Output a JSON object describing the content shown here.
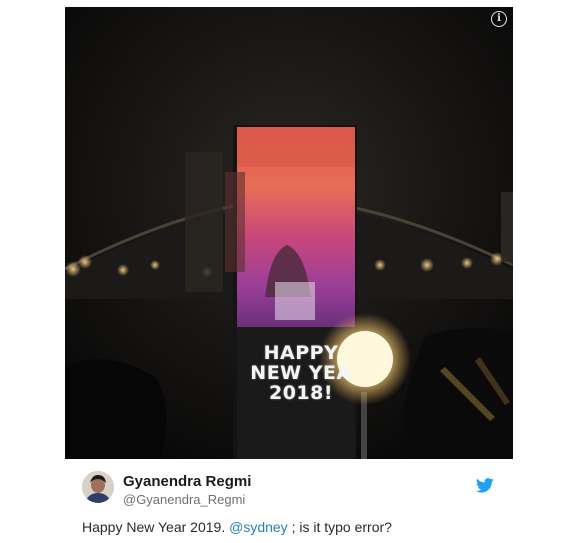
{
  "media": {
    "info_icon": "info-icon",
    "projection_lines": [
      "HAPPY",
      "NEW YEA",
      "2018!"
    ]
  },
  "author": {
    "name": "Gyanendra Regmi",
    "handle": "@Gyanendra_Regmi",
    "avatar_icon": "user-avatar"
  },
  "tweet": {
    "text_before": "Happy New Year 2019. ",
    "mention": "@sydney",
    "text_after": " ; is it typo error?"
  },
  "colors": {
    "twitter_blue": "#1da1f2",
    "mention_blue": "#2a7ec3"
  },
  "icons": {
    "brand": "twitter-bird-icon"
  }
}
